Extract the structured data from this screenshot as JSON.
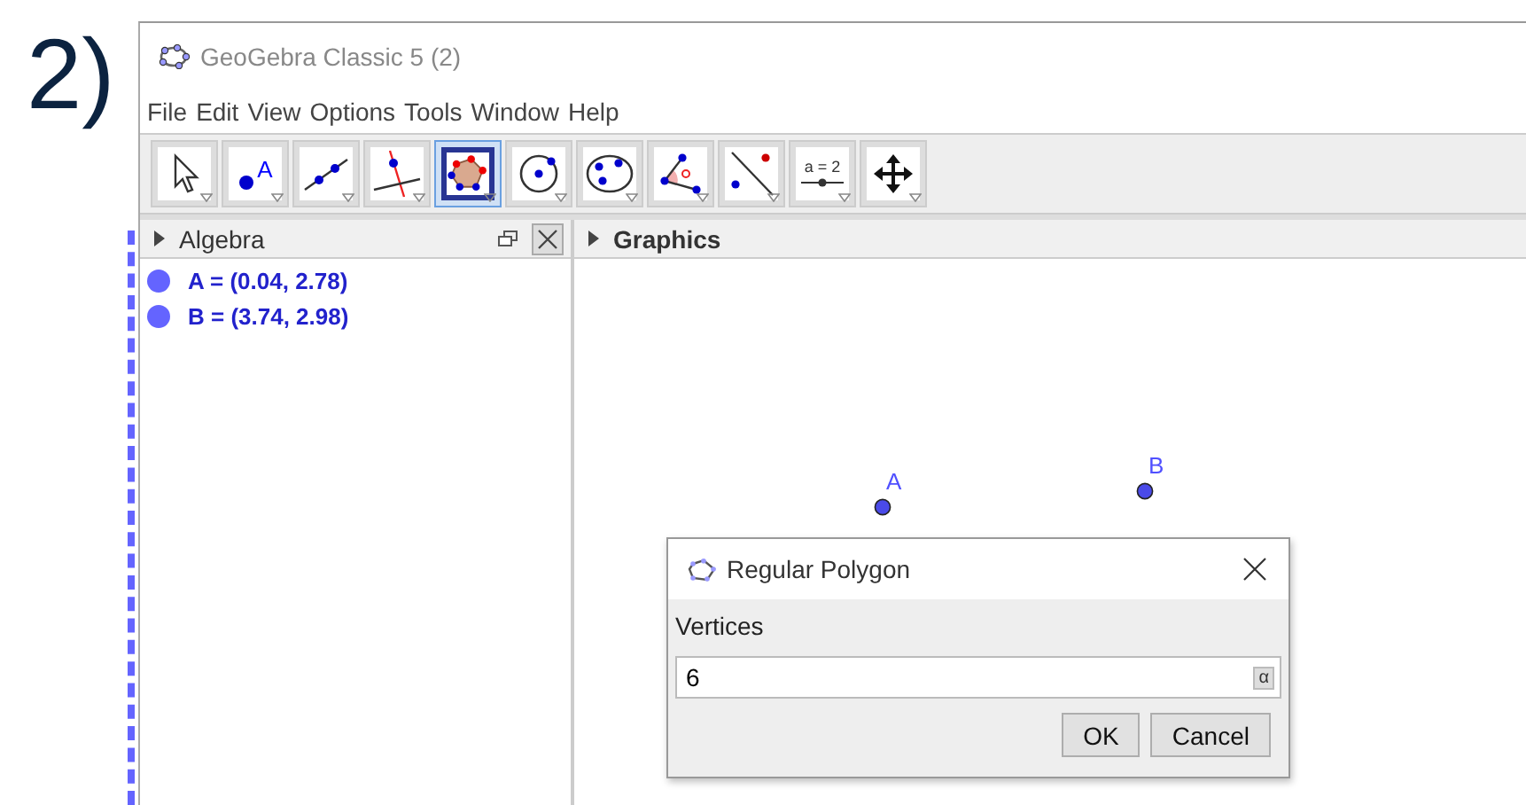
{
  "step_label": "2)",
  "window": {
    "title": "GeoGebra Classic 5 (2)"
  },
  "menu": [
    "File",
    "Edit",
    "View",
    "Options",
    "Tools",
    "Window",
    "Help"
  ],
  "toolbar": [
    {
      "kind": "move",
      "selected": false
    },
    {
      "kind": "point",
      "label": "A",
      "selected": false
    },
    {
      "kind": "line",
      "selected": false
    },
    {
      "kind": "perpendicular",
      "selected": false
    },
    {
      "kind": "polygon",
      "selected": true
    },
    {
      "kind": "circle",
      "selected": false
    },
    {
      "kind": "ellipse",
      "selected": false
    },
    {
      "kind": "angle",
      "selected": false
    },
    {
      "kind": "reflect",
      "selected": false
    },
    {
      "kind": "slider",
      "label": "a = 2",
      "selected": false
    },
    {
      "kind": "move-view",
      "selected": false
    }
  ],
  "algebra": {
    "title": "Algebra",
    "items": [
      "A = (0.04, 2.78)",
      "B = (3.74, 2.98)"
    ]
  },
  "graphics": {
    "title": "Graphics",
    "points": [
      "A",
      "B"
    ]
  },
  "dialog": {
    "title": "Regular Polygon",
    "field_label": "Vertices",
    "value": "6",
    "keyboard_button": "α",
    "buttons": [
      "OK",
      "Cancel"
    ]
  }
}
